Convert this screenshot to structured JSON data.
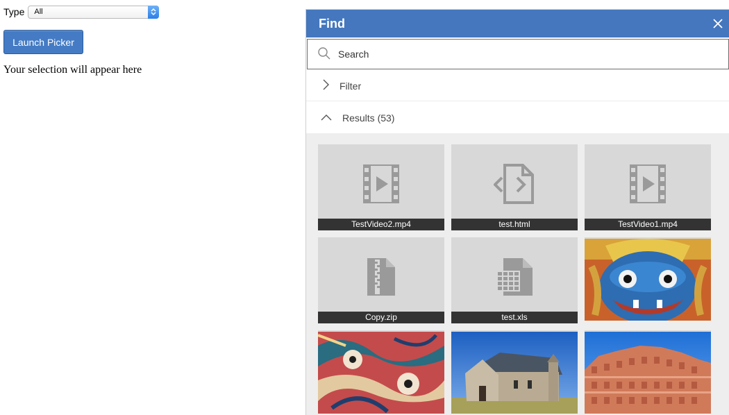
{
  "controls": {
    "type_label": "Type",
    "type_value": "All",
    "launch_label": "Launch Picker",
    "selection_text": "Your selection will appear here"
  },
  "picker": {
    "title": "Find",
    "search_placeholder": "Search",
    "filter_label": "Filter",
    "results_label": "Results (53)",
    "accent_color": "#4477be",
    "items": [
      {
        "name": "TestVideo2.mp4",
        "icon": "video-icon"
      },
      {
        "name": "test.html",
        "icon": "code-file-icon"
      },
      {
        "name": "TestVideo1.mp4",
        "icon": "video-icon"
      },
      {
        "name": "Copy.zip",
        "icon": "zip-file-icon"
      },
      {
        "name": "test.xls",
        "icon": "spreadsheet-file-icon"
      },
      {
        "name": "",
        "icon": "photo-thai-mask"
      },
      {
        "name": "",
        "icon": "photo-tapestry"
      },
      {
        "name": "",
        "icon": "photo-stone-church"
      },
      {
        "name": "",
        "icon": "photo-palace"
      }
    ]
  }
}
